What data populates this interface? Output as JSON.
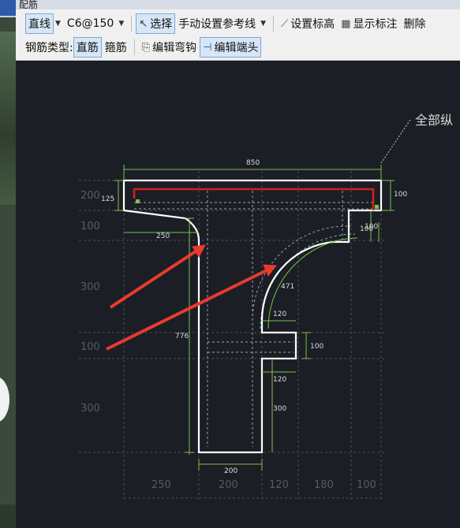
{
  "window": {
    "tab_title": "配筋"
  },
  "toolbar": {
    "line_mode": "直线",
    "rebar_spec": "C6@150",
    "select": "选择",
    "manual_ref_line": "手动设置参考线",
    "set_elevation": "设置标高",
    "show_annotation": "显示标注",
    "delete": "删除",
    "rebar_type_label": "钢筋类型:",
    "straight_rebar": "直筋",
    "stirrup": "箍筋",
    "edit_hook": "编辑弯钩",
    "edit_end": "编辑端头"
  },
  "drawing": {
    "callout": "全部纵",
    "dims": {
      "top_width": "850",
      "top_height": "100",
      "left_125": "125",
      "stem_offset": "250",
      "right_100a": "100",
      "right_100b": "100",
      "arc": "471",
      "notch_120a": "120",
      "notch_100": "100",
      "notch_120b": "120",
      "web_776": "776",
      "lower_300": "300",
      "bottom_200": "200"
    },
    "grid_left": [
      "200",
      "100",
      "300",
      "100",
      "300"
    ],
    "grid_bottom": [
      "250",
      "200",
      "120",
      "180",
      "100"
    ]
  },
  "colors": {
    "outline": "#ffffff",
    "dim": "#7dc246",
    "rebar": "#d42020",
    "arrow": "#e83b2e",
    "guide": "#8c9ad6"
  }
}
